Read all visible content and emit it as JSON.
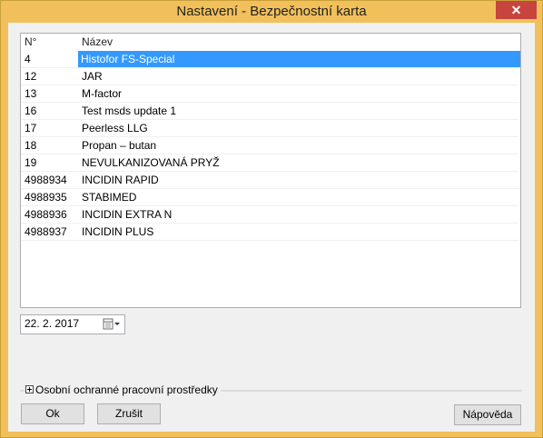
{
  "window": {
    "title": "Nastavení - Bezpečnostní karta",
    "close_glyph": "✕"
  },
  "list": {
    "columns": [
      "N°",
      "Název"
    ],
    "rows": [
      {
        "num": "4",
        "name": "Histofor FS-Special",
        "selected": true
      },
      {
        "num": "12",
        "name": "JAR",
        "selected": false
      },
      {
        "num": "13",
        "name": "M-factor",
        "selected": false
      },
      {
        "num": "16",
        "name": "Test msds update 1",
        "selected": false
      },
      {
        "num": "17",
        "name": "Peerless LLG",
        "selected": false
      },
      {
        "num": "18",
        "name": "Propan – butan",
        "selected": false
      },
      {
        "num": "19",
        "name": "NEVULKANIZOVANÁ PRYŽ",
        "selected": false
      },
      {
        "num": "4988934",
        "name": "INCIDIN RAPID",
        "selected": false
      },
      {
        "num": "4988935",
        "name": "STABIMED",
        "selected": false
      },
      {
        "num": "4988936",
        "name": "INCIDIN EXTRA N",
        "selected": false
      },
      {
        "num": "4988937",
        "name": "INCIDIN PLUS",
        "selected": false
      }
    ]
  },
  "date": {
    "value": "22.   2. 2017",
    "icon": "calendar-icon"
  },
  "section": {
    "label": "Osobní ochranné pracovní prostředky",
    "icon": "plus-icon"
  },
  "buttons": {
    "ok": "Ok",
    "cancel": "Zrušit",
    "help": "Nápověda"
  },
  "colors": {
    "titlebar": "#f1c05a",
    "selection": "#3399ff",
    "close": "#c7453d"
  }
}
